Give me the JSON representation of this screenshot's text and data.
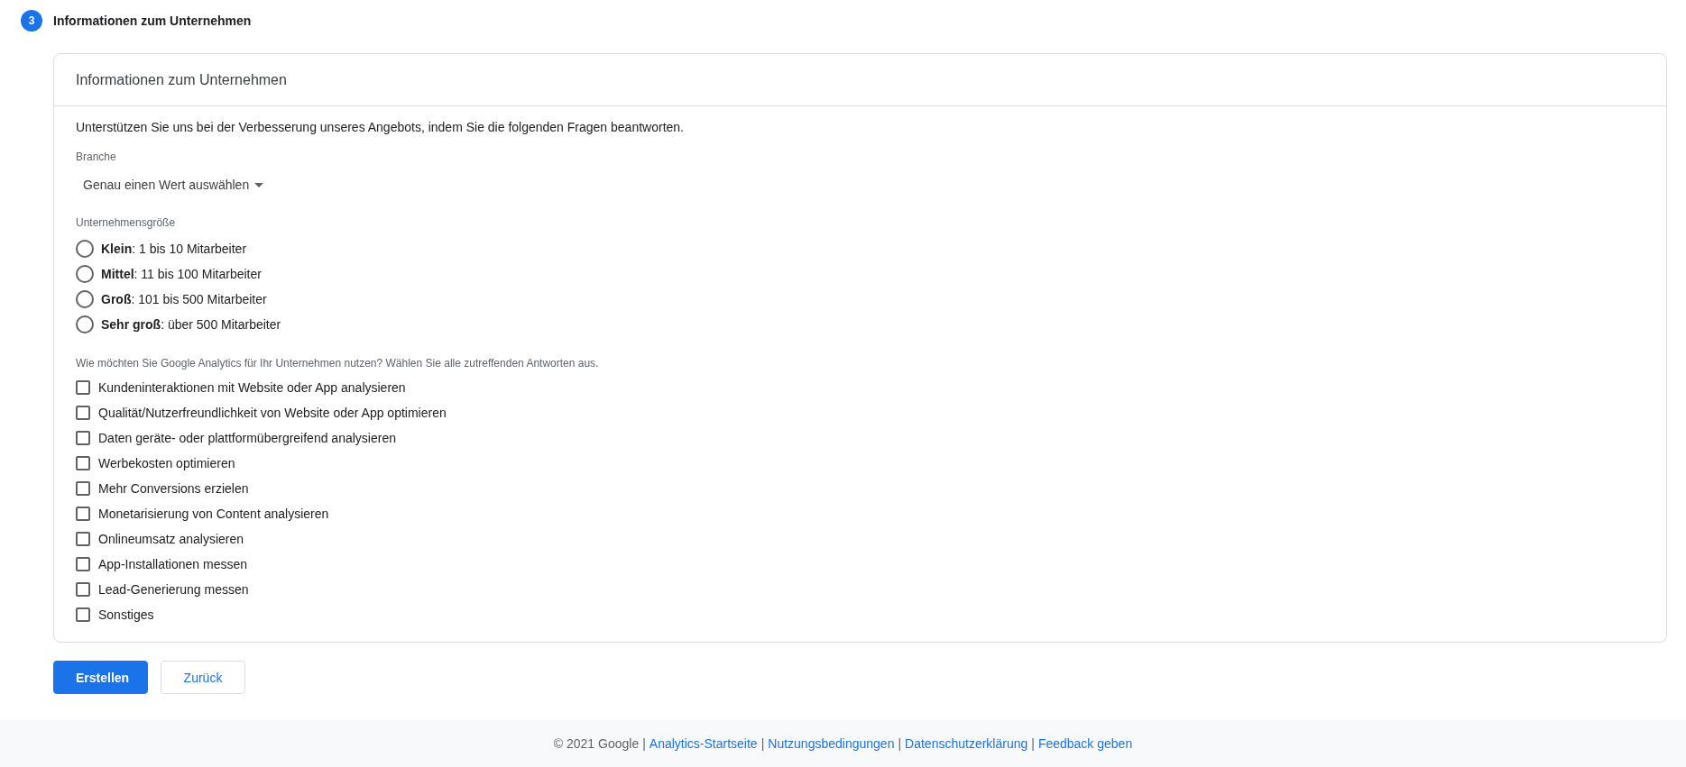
{
  "step": {
    "number": "3",
    "title": "Informationen zum Unternehmen"
  },
  "card": {
    "title": "Informationen zum Unternehmen",
    "intro": "Unterstützen Sie uns bei der Verbesserung unseres Angebots, indem Sie die folgenden Fragen beantworten.",
    "industry": {
      "label": "Branche",
      "value": "Genau einen Wert auswählen"
    },
    "size": {
      "label": "Unternehmensgröße",
      "options": [
        {
          "label": "**Klein**: 1 bis 10 Mitarbeiter",
          "selected": false
        },
        {
          "label": "**Mittel**: 11 bis 100 Mitarbeiter",
          "selected": false
        },
        {
          "label": "**Groß**: 101 bis 500 Mitarbeiter",
          "selected": false
        },
        {
          "label": "**Sehr groß**: über 500 Mitarbeiter",
          "selected": false
        }
      ]
    },
    "usage": {
      "label": "Wie möchten Sie Google Analytics für Ihr Unternehmen nutzen? Wählen Sie alle zutreffenden Antworten aus.",
      "options": [
        {
          "label": "Kundeninteraktionen mit Website oder App analysieren",
          "checked": false
        },
        {
          "label": "Qualität/Nutzerfreundlichkeit von Website oder App optimieren",
          "checked": false
        },
        {
          "label": "Daten geräte- oder plattformübergreifend analysieren",
          "checked": false
        },
        {
          "label": "Werbekosten optimieren",
          "checked": false
        },
        {
          "label": "Mehr Conversions erzielen",
          "checked": false
        },
        {
          "label": "Monetarisierung von Content analysieren",
          "checked": false
        },
        {
          "label": "Onlineumsatz analysieren",
          "checked": false
        },
        {
          "label": "App-Installationen messen",
          "checked": false
        },
        {
          "label": "Lead-Generierung messen",
          "checked": false
        },
        {
          "label": "Sonstiges",
          "checked": false
        }
      ]
    }
  },
  "buttons": [
    {
      "label": "Erstellen",
      "kind": "primary"
    },
    {
      "label": "Zurück",
      "kind": "secondary"
    }
  ],
  "footer": {
    "copyright": "© 2021 Google",
    "links": [
      {
        "separator": "|",
        "label": "Analytics-Startseite"
      },
      {
        "separator": "|",
        "label": "Nutzungsbedingungen"
      },
      {
        "separator": "|",
        "label": "Datenschutzerklärung"
      },
      {
        "separator": "|",
        "label": "Feedback geben"
      }
    ]
  }
}
